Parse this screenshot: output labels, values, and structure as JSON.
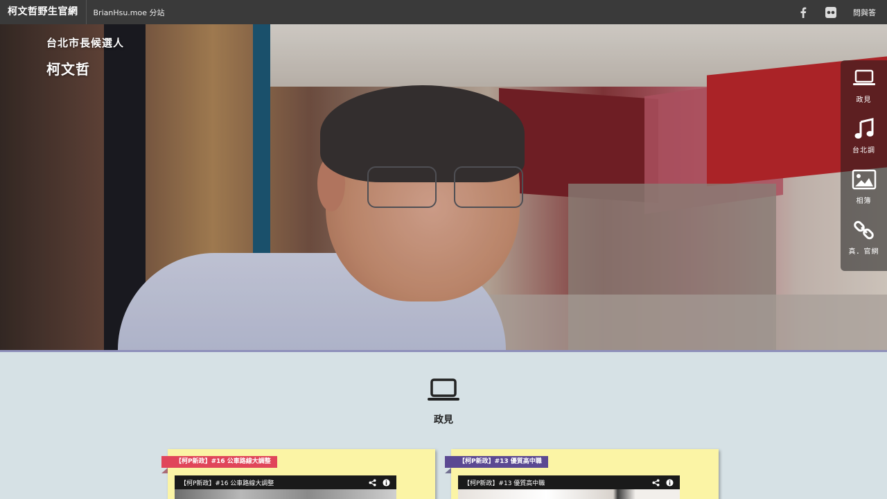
{
  "topbar": {
    "brand": "柯文哲野生官網",
    "subsite": "BrianHsu.moe 分站",
    "icons": [
      "facebook-icon",
      "flickr-icon"
    ],
    "qa_label": "問與答"
  },
  "hero": {
    "subtitle": "台北市長候選人",
    "name": "柯文哲"
  },
  "sidenav": {
    "items": [
      {
        "icon": "laptop-icon",
        "label": "政見"
      },
      {
        "icon": "music-note-icon",
        "label": "台北調"
      },
      {
        "icon": "image-icon",
        "label": "相簿"
      },
      {
        "icon": "link-icon",
        "label": "真．官網"
      }
    ]
  },
  "section": {
    "icon": "laptop-icon",
    "title": "政見"
  },
  "cards": [
    {
      "ribbon": "【柯P新政】#16 公車路線大調整",
      "video_title": "【柯P新政】#16 公車路線大調整",
      "accent": "#e0455a"
    },
    {
      "ribbon": "【柯P新政】#13 優質高中職",
      "video_title": "【柯P新政】#13 優質高中職",
      "accent": "#5b4992"
    }
  ]
}
